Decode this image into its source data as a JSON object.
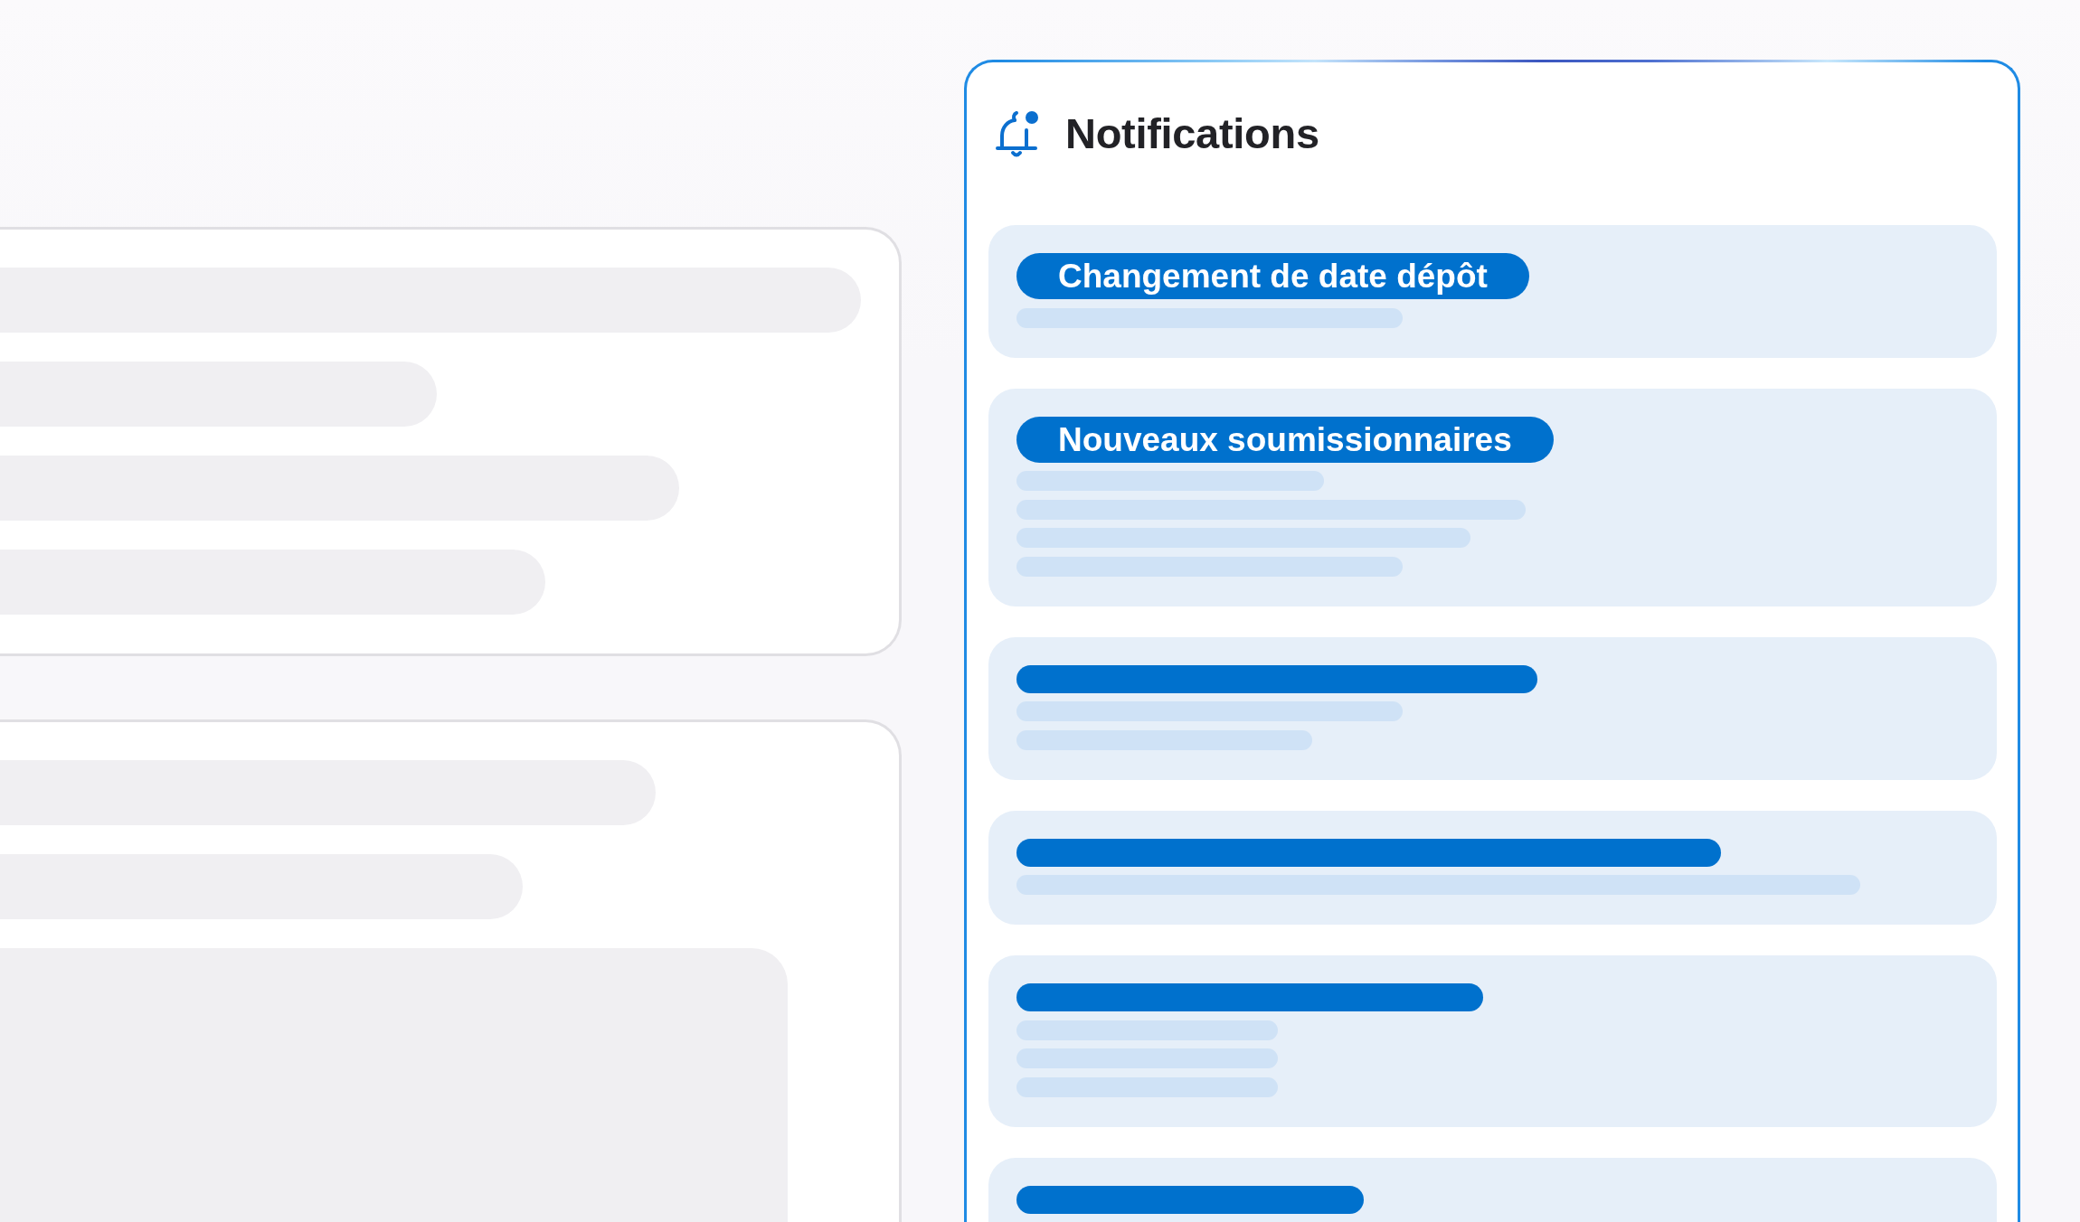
{
  "panel": {
    "title": "Notifications"
  },
  "notifications": [
    {
      "kind": "titled",
      "title": "Changement de date dépôt"
    },
    {
      "kind": "titled",
      "title": "Nouveaux soumissionnaires"
    },
    {
      "kind": "placeholder"
    },
    {
      "kind": "placeholder"
    },
    {
      "kind": "placeholder"
    },
    {
      "kind": "placeholder"
    }
  ]
}
